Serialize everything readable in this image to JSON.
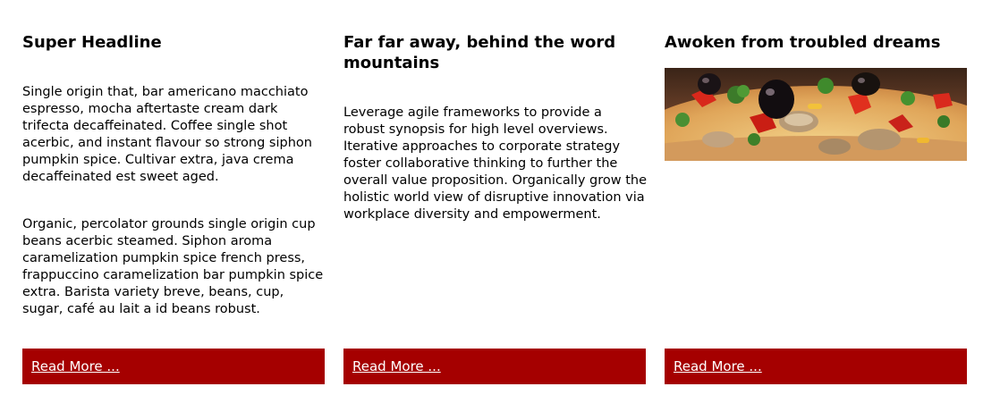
{
  "columns": [
    {
      "headline": "Super Headline",
      "paragraphs": [
        "Single origin that, bar americano macchiato espresso, mocha aftertaste cream dark trifecta decaffeinated. Coffee single shot acerbic, and instant flavour so strong siphon pumpkin spice. Cultivar extra, java crema decaffeinated est sweet aged.",
        "Organic, percolator grounds single origin cup beans acerbic steamed. Siphon aroma caramelization pumpkin spice french press, frappuccino caramelization bar pumpkin spice extra. Barista variety breve, beans, cup, sugar, café au lait a id beans robust."
      ],
      "link_label": "Read More ..."
    },
    {
      "headline": "Far far away, behind the word mountains",
      "paragraphs": [
        "Leverage agile frameworks to provide a robust synopsis for high level overviews. Iterative approaches to corporate strategy foster collaborative thinking to further the overall value proposition. Organically grow the holistic world view of disruptive innovation via workplace diversity and empowerment."
      ],
      "link_label": "Read More ..."
    },
    {
      "headline": "Awoken from troubled dreams",
      "image": "pizza-photo",
      "link_label": "Read More ..."
    }
  ],
  "colors": {
    "button_background": "#a50000",
    "link_text": "#ffffff",
    "text": "#000000"
  }
}
